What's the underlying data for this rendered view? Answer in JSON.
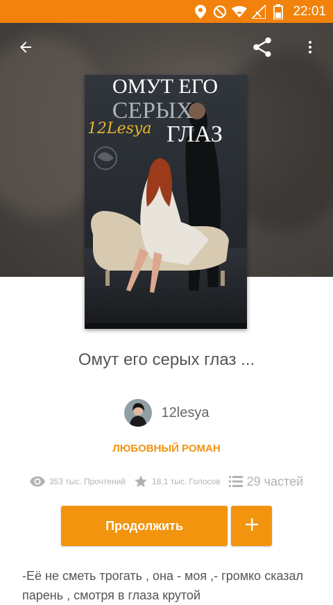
{
  "status_bar": {
    "time": "22:01"
  },
  "toolbar": {
    "back_icon": "arrow-back-icon",
    "share_icon": "share-icon",
    "menu_icon": "more-vertical-icon"
  },
  "book": {
    "cover_title_line1": "ОМУТ ЕГО",
    "cover_title_line2": "СЕРЫХ",
    "cover_title_line3": "ГЛАЗ",
    "cover_author": "12Lesya",
    "title": "Омут его серых глаз ...",
    "author": "12lesya",
    "genre": "ЛЮБОВНЫЙ РОМАН",
    "reads": "353 тыс. Прочтений",
    "votes": "18,1 тыс. Голосов",
    "parts": "29 частей",
    "description": "-Её не сметь трогать , она - моя ,- громко сказал парень , смотря в глаза крутой"
  },
  "actions": {
    "continue_label": "Продолжить",
    "add_label": "+"
  },
  "colors": {
    "accent": "#f2940e",
    "status_bar": "#f2820b"
  }
}
